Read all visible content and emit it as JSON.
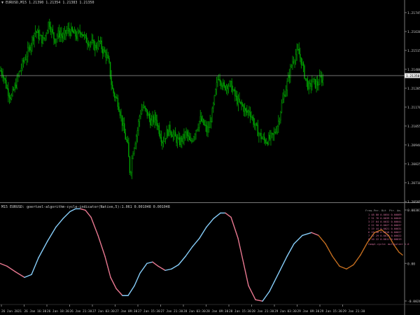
{
  "header": {
    "symbol_line": "EURUSD,M15",
    "ohlc": "1.21390 1.21354 1.21383 1.21350",
    "indicator_line": "M15 EURUSD: goertzel-algorithm-cycle-indicator(Native,5):1.061 0.001048 0.001048"
  },
  "price_axis": {
    "ticks": [
      "1.21745",
      "1.21630",
      "1.21515",
      "1.21400",
      "1.21285",
      "1.21170",
      "1.21055",
      "1.20940",
      "1.20825",
      "1.20710",
      "1.20595"
    ],
    "current_price": "1.21350"
  },
  "indicator_axis": {
    "ticks": [
      "0.003814",
      "0.00",
      "-0.002688"
    ]
  },
  "time_axis": {
    "labels": [
      "26 Jan 2021",
      "26 Jan 16:30",
      "26 Jan 18:30",
      "26 Jan 21:30",
      "27 Jan 03:30",
      "27 Jan 09:30",
      "27 Jan 15:30",
      "27 Jan 21:30",
      "28 Jan 03:30",
      "28 Jan 09:30",
      "28 Jan 15:30",
      "28 Jan 21:30",
      "29 Jan 03:30",
      "29 Jan 09:30",
      "29 Jan 15:30",
      "29 Jan 21:30"
    ]
  },
  "legend": {
    "header": [
      "Freq.",
      "Per.",
      "Bit",
      "Ptr.",
      "Am."
    ],
    "rows": [
      "1  48  80  0.0054  0.00069",
      "2  31  76  0.0039  0.00045",
      "3  27  64  0.0032  0.00041",
      "4  22  58  0.0027  0.00037",
      "5  19  44  0.0021  0.00031",
      "6  15  38  0.0018  0.00027",
      "7  12  29  0.0014  0.00022",
      "8  10  22  0.0011  0.00019"
    ],
    "footer": "Compl.cycle: multiplier 1.0"
  },
  "colors": {
    "background": "#000000",
    "bull_candle": "#00a800",
    "bear_candle": "#00a800",
    "current_line": "#9a9a9a",
    "wave_up": "#87cefa",
    "wave_down": "#e87890",
    "forecast": "#c87020",
    "axis_text": "#c8c8c8"
  },
  "chart_data": [
    {
      "type": "candlestick",
      "title": "EURUSD,M15",
      "ylim": [
        1.2054,
        1.2183
      ],
      "current_price": 1.2135,
      "close_path": [
        [
          0,
          1.214
        ],
        [
          4,
          1.2138
        ],
        [
          10,
          1.2128
        ],
        [
          16,
          1.2122
        ],
        [
          22,
          1.213
        ],
        [
          28,
          1.2139
        ],
        [
          34,
          1.2146
        ],
        [
          40,
          1.2152
        ],
        [
          46,
          1.216
        ],
        [
          50,
          1.2166
        ],
        [
          56,
          1.2162
        ],
        [
          62,
          1.2159
        ],
        [
          66,
          1.2165
        ],
        [
          70,
          1.2172
        ],
        [
          74,
          1.2165
        ],
        [
          78,
          1.216
        ],
        [
          82,
          1.2163
        ],
        [
          86,
          1.2164
        ],
        [
          90,
          1.2161
        ],
        [
          96,
          1.2166
        ],
        [
          102,
          1.2165
        ],
        [
          110,
          1.2162
        ],
        [
          116,
          1.2166
        ],
        [
          122,
          1.216
        ],
        [
          130,
          1.2158
        ],
        [
          136,
          1.2155
        ],
        [
          142,
          1.2158
        ],
        [
          148,
          1.2152
        ],
        [
          152,
          1.215
        ],
        [
          156,
          1.2143
        ],
        [
          160,
          1.2128
        ],
        [
          164,
          1.2123
        ],
        [
          168,
          1.212
        ],
        [
          172,
          1.2112
        ],
        [
          178,
          1.2098
        ],
        [
          182,
          1.2092
        ],
        [
          186,
          1.2072
        ],
        [
          190,
          1.2088
        ],
        [
          196,
          1.21
        ],
        [
          200,
          1.2112
        ],
        [
          204,
          1.2116
        ],
        [
          210,
          1.2112
        ],
        [
          216,
          1.2106
        ],
        [
          222,
          1.2109
        ],
        [
          226,
          1.2103
        ],
        [
          232,
          1.2094
        ],
        [
          236,
          1.2097
        ],
        [
          242,
          1.2102
        ],
        [
          246,
          1.2099
        ],
        [
          252,
          1.2095
        ],
        [
          256,
          1.2093
        ],
        [
          262,
          1.2096
        ],
        [
          266,
          1.2099
        ],
        [
          272,
          1.2092
        ],
        [
          276,
          1.2097
        ],
        [
          282,
          1.2104
        ],
        [
          286,
          1.2108
        ],
        [
          292,
          1.2104
        ],
        [
          296,
          1.21
        ],
        [
          300,
          1.2105
        ],
        [
          304,
          1.2114
        ],
        [
          308,
          1.2126
        ],
        [
          312,
          1.2137
        ],
        [
          316,
          1.2133
        ],
        [
          320,
          1.2128
        ],
        [
          324,
          1.2131
        ],
        [
          330,
          1.213
        ],
        [
          334,
          1.2125
        ],
        [
          340,
          1.2119
        ],
        [
          346,
          1.2117
        ],
        [
          352,
          1.2112
        ],
        [
          356,
          1.2114
        ],
        [
          360,
          1.2109
        ],
        [
          366,
          1.2102
        ],
        [
          372,
          1.2097
        ],
        [
          378,
          1.2094
        ],
        [
          384,
          1.2095
        ],
        [
          390,
          1.2097
        ],
        [
          394,
          1.2101
        ],
        [
          398,
          1.2107
        ],
        [
          402,
          1.2117
        ],
        [
          406,
          1.2124
        ],
        [
          410,
          1.2131
        ],
        [
          414,
          1.2139
        ],
        [
          418,
          1.2146
        ],
        [
          422,
          1.215
        ],
        [
          426,
          1.2152
        ],
        [
          430,
          1.2147
        ],
        [
          434,
          1.2139
        ],
        [
          438,
          1.2132
        ],
        [
          442,
          1.2128
        ],
        [
          446,
          1.2133
        ],
        [
          450,
          1.2131
        ],
        [
          454,
          1.2131
        ],
        [
          458,
          1.2135
        ],
        [
          462,
          1.2133
        ]
      ]
    },
    {
      "type": "line",
      "title": "goertzel-algorithm-cycle-indicator",
      "ylim": [
        -0.002688,
        0.003814
      ],
      "x": [
        0,
        10,
        22,
        35,
        45,
        55,
        68,
        80,
        90,
        100,
        108,
        115,
        122,
        130,
        140,
        150,
        158,
        166,
        175,
        183,
        192,
        200,
        210,
        218,
        226,
        236,
        245,
        255,
        265,
        275,
        285,
        295,
        305,
        315,
        322,
        330,
        340,
        348,
        355,
        365,
        375,
        385,
        392,
        400,
        410,
        420,
        432,
        445,
        455,
        465,
        475,
        485,
        495,
        505,
        515,
        525,
        535,
        545,
        555,
        563,
        570,
        575
      ],
      "y": [
        0.0,
        -0.0002,
        -0.0006,
        -0.001,
        -0.0008,
        0.0004,
        0.0016,
        0.0026,
        0.0032,
        0.0037,
        0.0039,
        0.0039,
        0.0038,
        0.0033,
        0.002,
        0.0005,
        -0.001,
        -0.0018,
        -0.0023,
        -0.0023,
        -0.0016,
        -0.0007,
        0.0,
        0.0001,
        -0.0002,
        -0.0005,
        -0.0004,
        -0.0001,
        0.0005,
        0.0012,
        0.0018,
        0.0026,
        0.0032,
        0.0036,
        0.0036,
        0.0033,
        0.0018,
        0.0,
        -0.0016,
        -0.0026,
        -0.0027,
        -0.002,
        -0.0013,
        -0.0005,
        0.0005,
        0.0014,
        0.002,
        0.0022,
        0.002,
        0.0014,
        0.0005,
        -0.0002,
        -0.0004,
        -0.0001,
        0.0006,
        0.0015,
        0.0022,
        0.0024,
        0.002,
        0.0013,
        0.0008,
        0.0006
      ],
      "forecast_from_x": 450
    }
  ]
}
